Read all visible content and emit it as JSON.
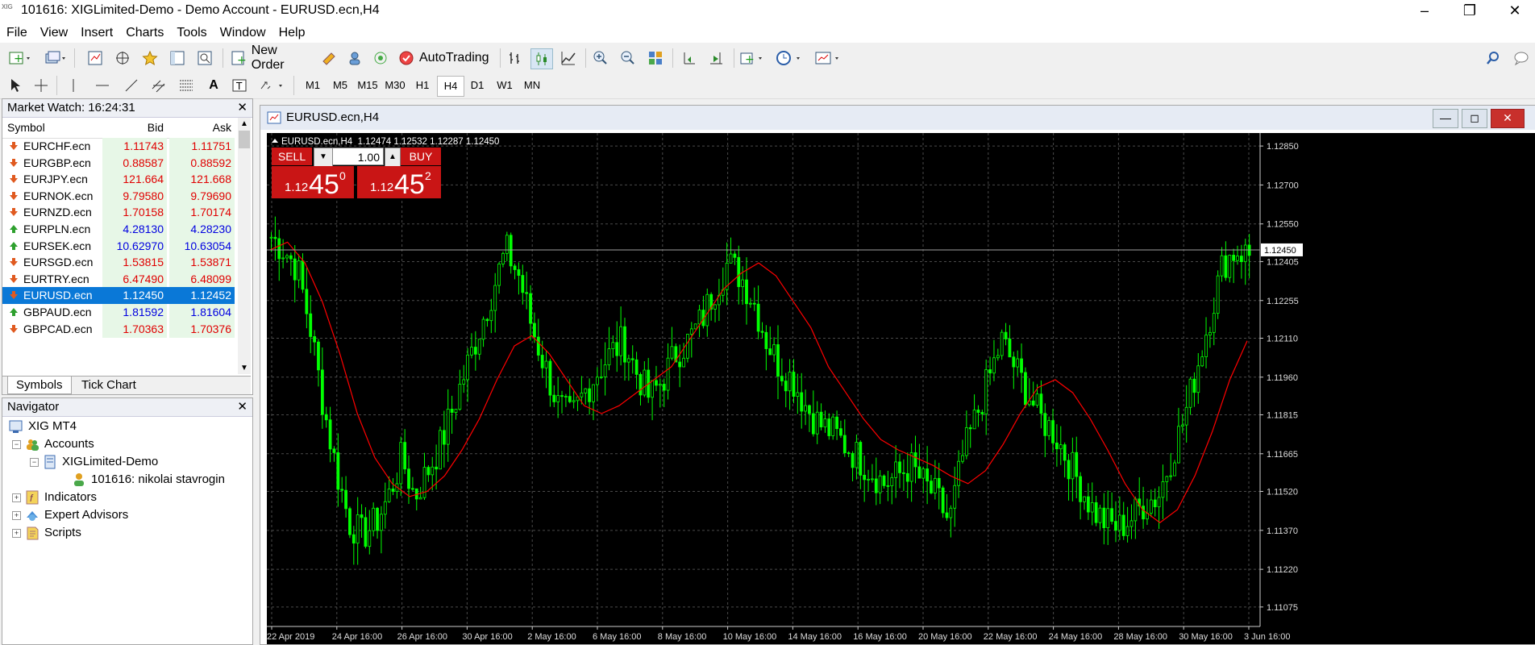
{
  "window": {
    "title": "101616: XIGLimited-Demo - Demo Account - EURUSD.ecn,H4",
    "app_icon_text": "XIG"
  },
  "menu": [
    "File",
    "View",
    "Insert",
    "Charts",
    "Tools",
    "Window",
    "Help"
  ],
  "toolbar": {
    "new_order_label": "New Order",
    "autotrading_label": "AutoTrading"
  },
  "timeframes": [
    "M1",
    "M5",
    "M15",
    "M30",
    "H1",
    "H4",
    "D1",
    "W1",
    "MN"
  ],
  "active_timeframe": "H4",
  "market_watch": {
    "title": "Market Watch: 16:24:31",
    "columns": {
      "symbol": "Symbol",
      "bid": "Bid",
      "ask": "Ask"
    },
    "rows": [
      {
        "symbol": "EURCHF.ecn",
        "bid": "1.11743",
        "ask": "1.11751",
        "dir": "down"
      },
      {
        "symbol": "EURGBP.ecn",
        "bid": "0.88587",
        "ask": "0.88592",
        "dir": "down"
      },
      {
        "symbol": "EURJPY.ecn",
        "bid": "121.664",
        "ask": "121.668",
        "dir": "down"
      },
      {
        "symbol": "EURNOK.ecn",
        "bid": "9.79580",
        "ask": "9.79690",
        "dir": "down"
      },
      {
        "symbol": "EURNZD.ecn",
        "bid": "1.70158",
        "ask": "1.70174",
        "dir": "down"
      },
      {
        "symbol": "EURPLN.ecn",
        "bid": "4.28130",
        "ask": "4.28230",
        "dir": "up"
      },
      {
        "symbol": "EURSEK.ecn",
        "bid": "10.62970",
        "ask": "10.63054",
        "dir": "up"
      },
      {
        "symbol": "EURSGD.ecn",
        "bid": "1.53815",
        "ask": "1.53871",
        "dir": "down"
      },
      {
        "symbol": "EURTRY.ecn",
        "bid": "6.47490",
        "ask": "6.48099",
        "dir": "down"
      },
      {
        "symbol": "EURUSD.ecn",
        "bid": "1.12450",
        "ask": "1.12452",
        "dir": "down",
        "selected": true
      },
      {
        "symbol": "GBPAUD.ecn",
        "bid": "1.81592",
        "ask": "1.81604",
        "dir": "up"
      },
      {
        "symbol": "GBPCAD.ecn",
        "bid": "1.70363",
        "ask": "1.70376",
        "dir": "down"
      }
    ],
    "tabs": [
      "Symbols",
      "Tick Chart"
    ]
  },
  "navigator": {
    "title": "Navigator",
    "items": {
      "root": "XIG MT4",
      "accounts": "Accounts",
      "server": "XIGLimited-Demo",
      "account": "101616: nikolai stavrogin",
      "indicators": "Indicators",
      "experts": "Expert Advisors",
      "scripts": "Scripts"
    }
  },
  "chart": {
    "window_title": "EURUSD.ecn,H4",
    "info_line": "EURUSD.ecn,H4  1.12474 1.12532 1.12287 1.12450",
    "one_click": {
      "sell_label": "SELL",
      "buy_label": "BUY",
      "lot": "1.00",
      "sell_prefix": "1.12",
      "sell_big": "45",
      "sell_sup": "0",
      "buy_prefix": "1.12",
      "buy_big": "45",
      "buy_sup": "2"
    },
    "current_price_label": "1.12450"
  },
  "colors": {
    "bull_candle": "#00ff00",
    "bear_candle": "#00ff00",
    "ma_line": "#ff0000",
    "bid_line": "#a0a0a0",
    "chart_bg": "#000000",
    "grid": "#4a4a4a"
  },
  "chart_data": {
    "type": "candlestick",
    "symbol": "EURUSD.ecn",
    "timeframe": "H4",
    "ylim": [
      1.11,
      1.129
    ],
    "y_ticks": [
      "1.12850",
      "1.12700",
      "1.12550",
      "1.12405",
      "1.12255",
      "1.12110",
      "1.11960",
      "1.11815",
      "1.11665",
      "1.11520",
      "1.11370",
      "1.11220",
      "1.11075"
    ],
    "x_ticks": [
      "22 Apr 2019",
      "24 Apr 16:00",
      "26 Apr 16:00",
      "30 Apr 16:00",
      "2 May 16:00",
      "6 May 16:00",
      "8 May 16:00",
      "10 May 16:00",
      "14 May 16:00",
      "16 May 16:00",
      "20 May 16:00",
      "22 May 16:00",
      "24 May 16:00",
      "28 May 16:00",
      "30 May 16:00",
      "3 Jun 16:00"
    ],
    "close_path": [
      1.125,
      1.1245,
      1.1238,
      1.1215,
      1.1185,
      1.116,
      1.114,
      1.1135,
      1.114,
      1.115,
      1.1165,
      1.115,
      1.116,
      1.117,
      1.1185,
      1.12,
      1.1215,
      1.123,
      1.1245,
      1.1235,
      1.1215,
      1.12,
      1.1185,
      1.118,
      1.119,
      1.1198,
      1.1205,
      1.121,
      1.1198,
      1.1188,
      1.1195,
      1.1205,
      1.121,
      1.1218,
      1.123,
      1.124,
      1.1235,
      1.1225,
      1.121,
      1.12,
      1.1195,
      1.1185,
      1.1178,
      1.1175,
      1.117,
      1.1165,
      1.116,
      1.1155,
      1.1158,
      1.1162,
      1.1155,
      1.115,
      1.114,
      1.1165,
      1.118,
      1.1195,
      1.121,
      1.12,
      1.119,
      1.118,
      1.1175,
      1.1165,
      1.1155,
      1.1145,
      1.114,
      1.1138,
      1.1142,
      1.1148,
      1.115,
      1.1165,
      1.118,
      1.12,
      1.122,
      1.124,
      1.1245,
      1.1243
    ],
    "ma_path": [
      1.1245,
      1.1248,
      1.124,
      1.1225,
      1.1205,
      1.1182,
      1.1165,
      1.1155,
      1.115,
      1.1152,
      1.1158,
      1.1168,
      1.118,
      1.1195,
      1.1208,
      1.1212,
      1.1205,
      1.1195,
      1.1185,
      1.1182,
      1.1185,
      1.119,
      1.1195,
      1.12,
      1.121,
      1.122,
      1.123,
      1.1236,
      1.124,
      1.1235,
      1.1225,
      1.1215,
      1.12,
      1.119,
      1.118,
      1.1172,
      1.1168,
      1.1165,
      1.1162,
      1.1158,
      1.1155,
      1.116,
      1.117,
      1.1182,
      1.1192,
      1.1195,
      1.119,
      1.118,
      1.1168,
      1.1155,
      1.1145,
      1.114,
      1.1145,
      1.1158,
      1.1175,
      1.1195,
      1.121
    ]
  }
}
